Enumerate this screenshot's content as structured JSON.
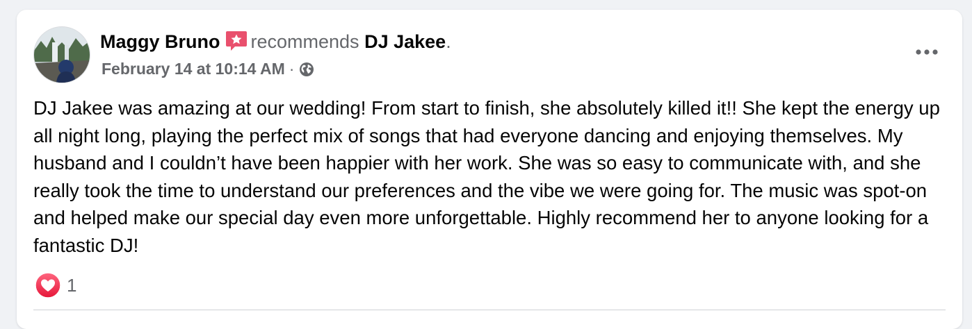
{
  "post": {
    "author": "Maggy Bruno",
    "action_verb": "recommends",
    "target": "DJ Jakee",
    "period": ".",
    "timestamp": "February 14 at 10:14 AM",
    "separator": "·",
    "audience_icon": "globe-icon",
    "recommend_icon": "recommendation-star-icon",
    "more_icon": "more-options-icon",
    "body": "DJ Jakee was amazing at our wedding! From start to finish, she absolutely killed it!! She kept the energy up all night long, playing the perfect mix of songs that had everyone dancing and enjoying themselves. My husband and I couldn’t have been happier with her work. She was so easy to communicate with, and she really took the time to understand our preferences and the vibe we were going for. The music was spot-on and helped make our special day even more unforgettable. Highly recommend her to anyone looking for a fantastic DJ!",
    "reaction_icon": "love-reaction-icon",
    "reaction_count": "1"
  },
  "colors": {
    "background": "#f0f2f5",
    "card": "#ffffff",
    "primary_text": "#050505",
    "secondary_text": "#65676b",
    "recommend_badge": "#e9506d",
    "love_reaction": "#f0284a"
  }
}
